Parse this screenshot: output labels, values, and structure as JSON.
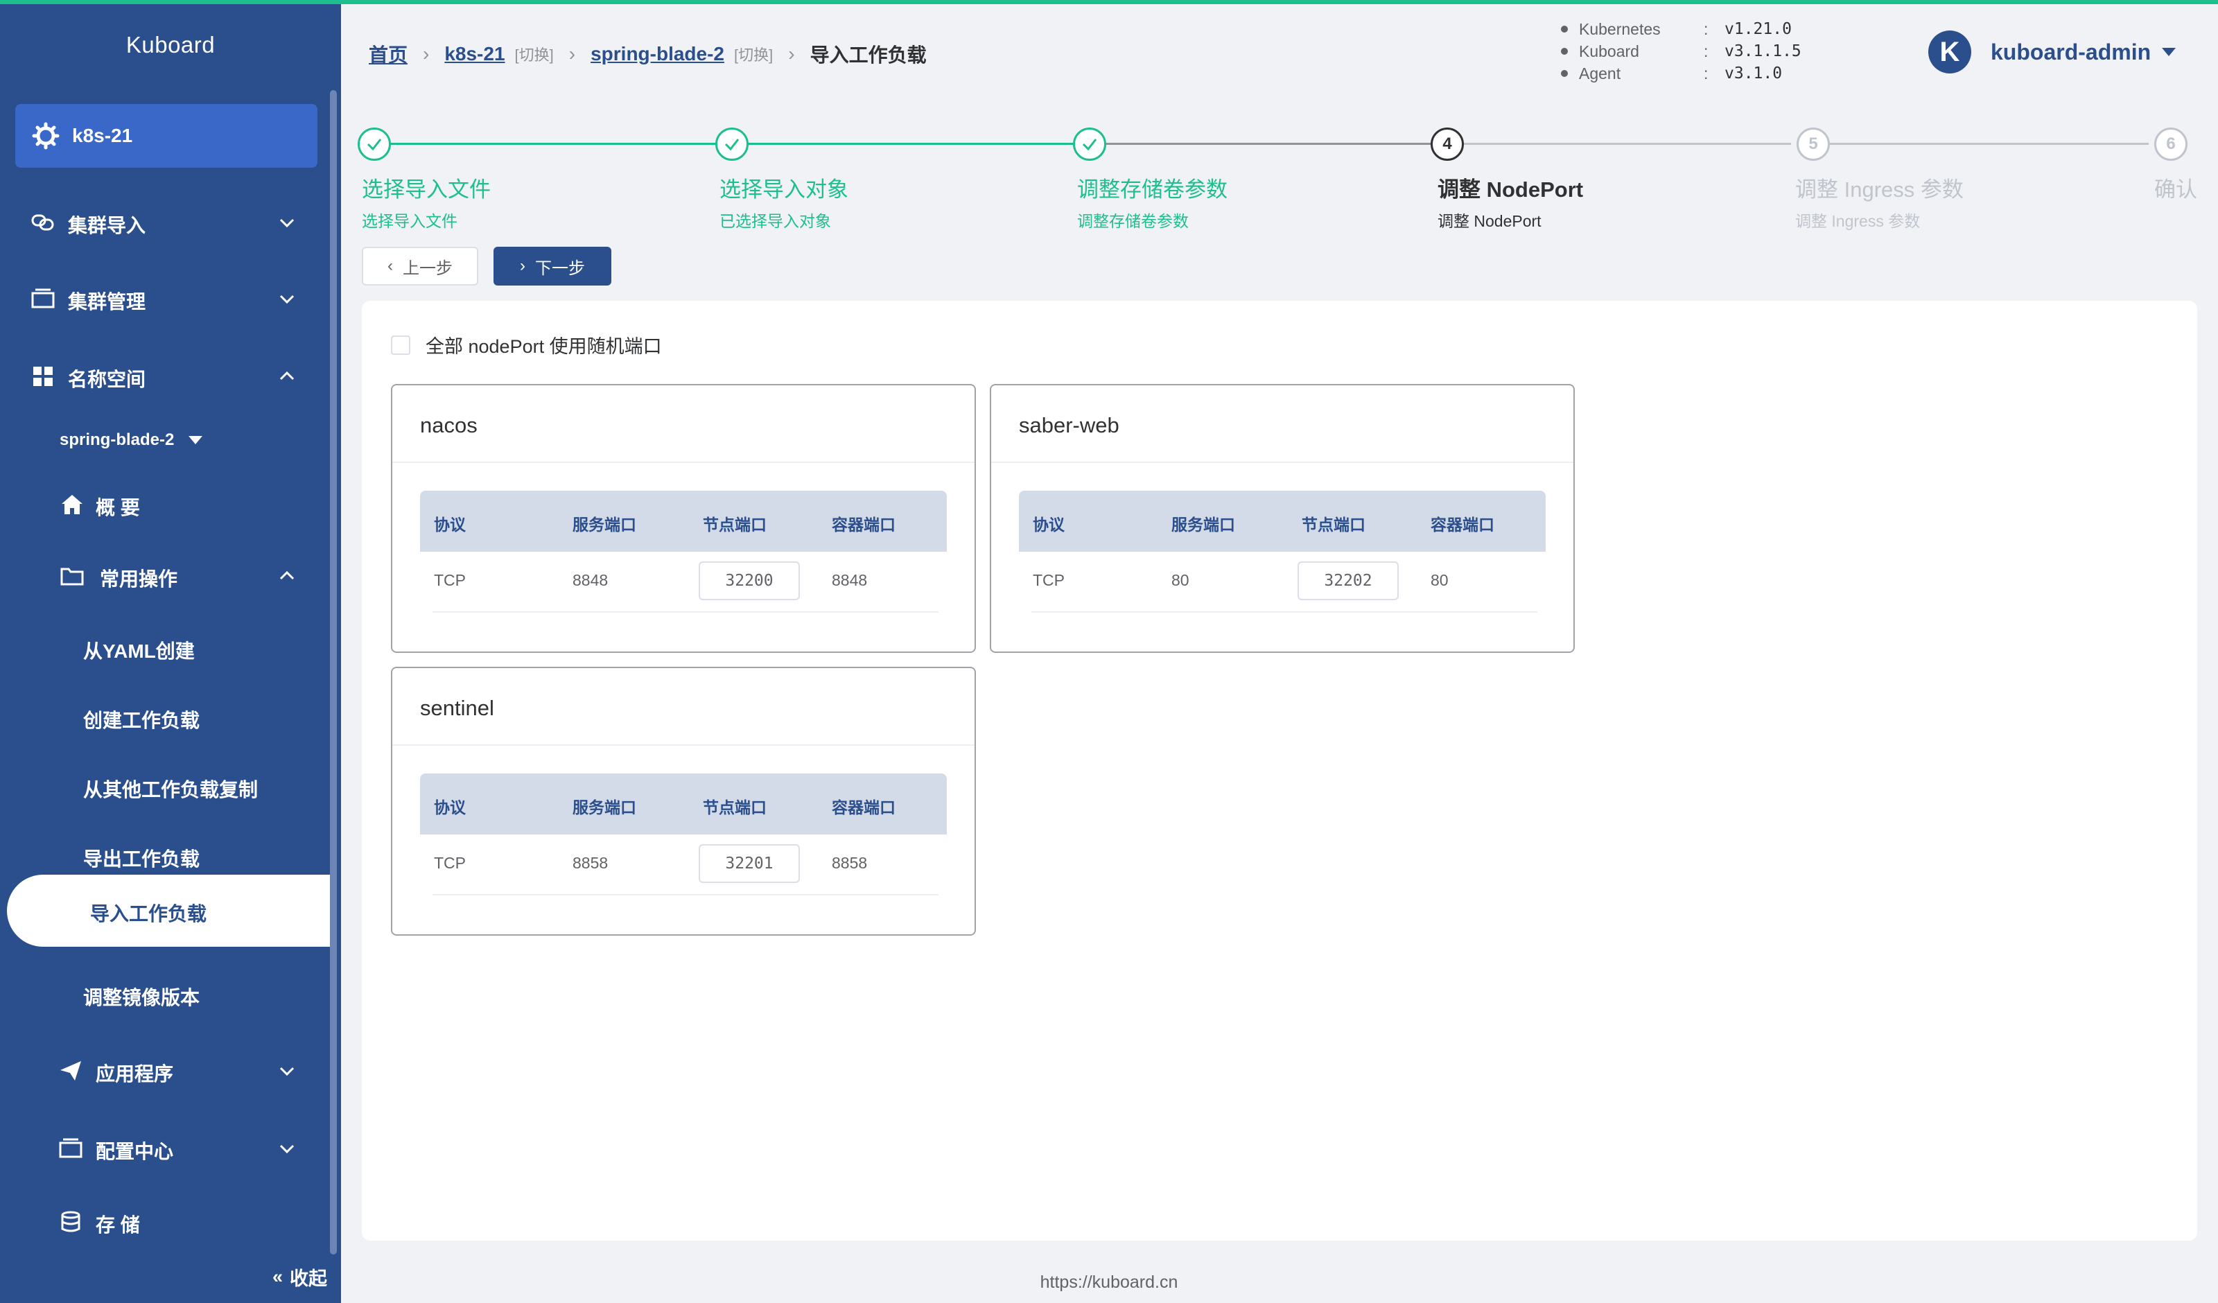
{
  "app": {
    "title": "Kuboard",
    "cluster": "k8s-21"
  },
  "sidebar": {
    "menu": [
      {
        "label": "集群导入"
      },
      {
        "label": "集群管理"
      },
      {
        "label": "名称空间"
      }
    ],
    "namespace": "spring-blade-2",
    "overview": "概 要",
    "common_ops": "常用操作",
    "sub_items": [
      "从YAML创建",
      "创建工作负载",
      "从其他工作负载复制",
      "导出工作负载",
      "导入工作负载",
      "调整镜像版本"
    ],
    "bottom_menu": [
      {
        "label": "应用程序"
      },
      {
        "label": "配置中心"
      },
      {
        "label": "存 储"
      }
    ],
    "collapse": "收起"
  },
  "breadcrumb": {
    "home": "首页",
    "cluster": "k8s-21",
    "cluster_switch": "[切换]",
    "namespace": "spring-blade-2",
    "namespace_switch": "[切换]",
    "current": "导入工作负载"
  },
  "versions": [
    {
      "name": "Kubernetes",
      "value": "v1.21.0"
    },
    {
      "name": "Kuboard",
      "value": "v3.1.1.5"
    },
    {
      "name": "Agent",
      "value": "v3.1.0"
    }
  ],
  "user": {
    "initial": "K",
    "name": "kuboard-admin"
  },
  "steps": [
    {
      "title": "选择导入文件",
      "desc": "选择导入文件",
      "status": "done"
    },
    {
      "title": "选择导入对象",
      "desc": "已选择导入对象",
      "status": "done"
    },
    {
      "title": "调整存储卷参数",
      "desc": "调整存储卷参数",
      "status": "done"
    },
    {
      "number": "4",
      "title": "调整 NodePort",
      "desc": "调整 NodePort",
      "status": "current"
    },
    {
      "number": "5",
      "title": "调整 Ingress 参数",
      "desc": "调整 Ingress 参数",
      "status": "pending"
    },
    {
      "number": "6",
      "title": "确认",
      "desc": "",
      "status": "pending"
    }
  ],
  "buttons": {
    "prev": "上一步",
    "next": "下一步"
  },
  "random_port_label": "全部 nodePort 使用随机端口",
  "table_headers": [
    "协议",
    "服务端口",
    "节点端口",
    "容器端口"
  ],
  "services": [
    {
      "name": "nacos",
      "protocol": "TCP",
      "service_port": "8848",
      "node_port": "32200",
      "container_port": "8848"
    },
    {
      "name": "saber-web",
      "protocol": "TCP",
      "service_port": "80",
      "node_port": "32202",
      "container_port": "80"
    },
    {
      "name": "sentinel",
      "protocol": "TCP",
      "service_port": "8858",
      "node_port": "32201",
      "container_port": "8858"
    }
  ],
  "footer": "https://kuboard.cn",
  "colors": {
    "sidebar": "#2b4f8c",
    "accent": "#1dbf8f",
    "primary": "#2b4f8c"
  }
}
